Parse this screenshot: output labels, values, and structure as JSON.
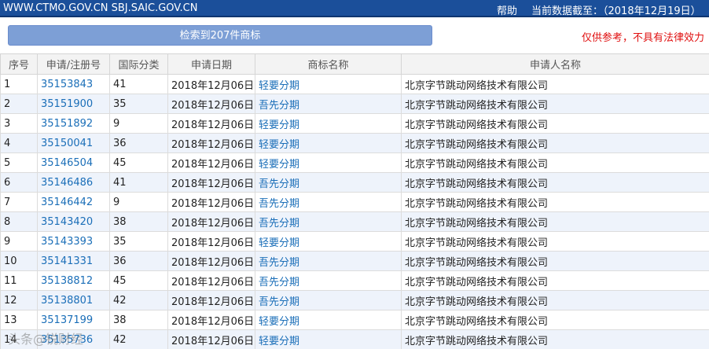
{
  "header": {
    "sites": "WWW.CTMO.GOV.CN SBJ.SAIC.GOV.CN",
    "help": "帮助",
    "as_of": "当前数据截至：（2018年12月19日）"
  },
  "result_bar": {
    "label": "检索到207件商标"
  },
  "disclaimer": "仅供参考，不具有法律效力",
  "table": {
    "headers": [
      "序号",
      "申请/注册号",
      "国际分类",
      "申请日期",
      "商标名称",
      "申请人名称"
    ],
    "rows": [
      {
        "no": "1",
        "reg": "35153843",
        "cls": "41",
        "date": "2018年12月06日",
        "name": "轻要分期",
        "applicant": "北京字节跳动网络技术有限公司"
      },
      {
        "no": "2",
        "reg": "35151900",
        "cls": "35",
        "date": "2018年12月06日",
        "name": "吾先分期",
        "applicant": "北京字节跳动网络技术有限公司"
      },
      {
        "no": "3",
        "reg": "35151892",
        "cls": "9",
        "date": "2018年12月06日",
        "name": "轻要分期",
        "applicant": "北京字节跳动网络技术有限公司"
      },
      {
        "no": "4",
        "reg": "35150041",
        "cls": "36",
        "date": "2018年12月06日",
        "name": "轻要分期",
        "applicant": "北京字节跳动网络技术有限公司"
      },
      {
        "no": "5",
        "reg": "35146504",
        "cls": "45",
        "date": "2018年12月06日",
        "name": "轻要分期",
        "applicant": "北京字节跳动网络技术有限公司"
      },
      {
        "no": "6",
        "reg": "35146486",
        "cls": "41",
        "date": "2018年12月06日",
        "name": "吾先分期",
        "applicant": "北京字节跳动网络技术有限公司"
      },
      {
        "no": "7",
        "reg": "35146442",
        "cls": "9",
        "date": "2018年12月06日",
        "name": "吾先分期",
        "applicant": "北京字节跳动网络技术有限公司"
      },
      {
        "no": "8",
        "reg": "35143420",
        "cls": "38",
        "date": "2018年12月06日",
        "name": "吾先分期",
        "applicant": "北京字节跳动网络技术有限公司"
      },
      {
        "no": "9",
        "reg": "35143393",
        "cls": "35",
        "date": "2018年12月06日",
        "name": "轻要分期",
        "applicant": "北京字节跳动网络技术有限公司"
      },
      {
        "no": "10",
        "reg": "35141331",
        "cls": "36",
        "date": "2018年12月06日",
        "name": "吾先分期",
        "applicant": "北京字节跳动网络技术有限公司"
      },
      {
        "no": "11",
        "reg": "35138812",
        "cls": "45",
        "date": "2018年12月06日",
        "name": "吾先分期",
        "applicant": "北京字节跳动网络技术有限公司"
      },
      {
        "no": "12",
        "reg": "35138801",
        "cls": "42",
        "date": "2018年12月06日",
        "name": "吾先分期",
        "applicant": "北京字节跳动网络技术有限公司"
      },
      {
        "no": "13",
        "reg": "35137199",
        "cls": "38",
        "date": "2018年12月06日",
        "name": "轻要分期",
        "applicant": "北京字节跳动网络技术有限公司"
      },
      {
        "no": "14",
        "reg": "35135736",
        "cls": "42",
        "date": "2018年12月06日",
        "name": "轻要分期",
        "applicant": "北京字节跳动网络技术有限公司"
      }
    ]
  },
  "watermark": "头条@锐财经"
}
